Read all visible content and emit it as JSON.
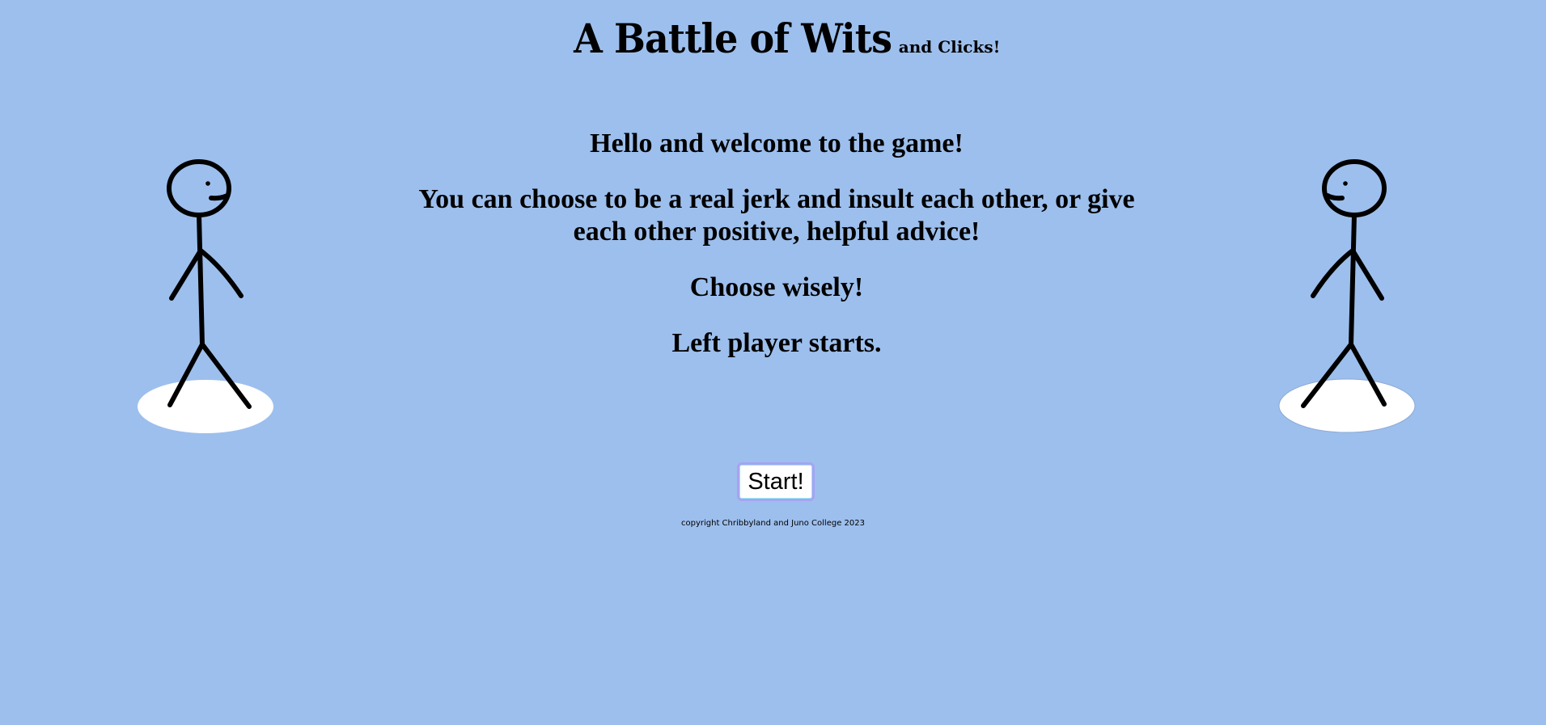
{
  "header": {
    "title": "A Battle of Wits",
    "subtitle": "and Clicks!"
  },
  "intro": {
    "welcome": "Hello and welcome to the game!",
    "choice": "You can choose to be a real jerk and insult each other, or give each other positive, helpful advice!",
    "advice": "Choose wisely!",
    "turn": "Left player starts."
  },
  "players": {
    "left": {
      "icon": "stick-figure-icon",
      "facing": "right"
    },
    "right": {
      "icon": "stick-figure-icon",
      "facing": "left"
    },
    "platform_color": "#ffffff"
  },
  "controls": {
    "start_label": "Start!"
  },
  "footer": {
    "copyright": "copyright Chribbyland and Juno College 2023"
  },
  "colors": {
    "background": "#9dbfed",
    "button_border": "#a9a2f2",
    "button_inner_border": "#8eeaf0"
  }
}
